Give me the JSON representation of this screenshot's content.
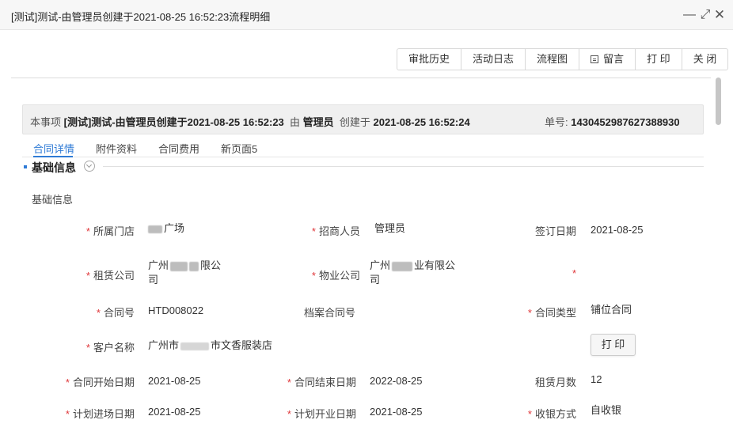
{
  "window": {
    "title": "[测试]测试-由管理员创建于2021-08-25 16:52:23流程明细",
    "minimize": "—",
    "maximize": "⤢",
    "close": "✕"
  },
  "toolbar": {
    "history": "审批历史",
    "activity_log": "活动日志",
    "flowchart": "流程图",
    "message": "留言",
    "print": "打 印",
    "close": "关 闭"
  },
  "info": {
    "prefix": "本事项",
    "item": "[测试]测试-由管理员创建于2021-08-25 16:52:23",
    "by": "由",
    "creator": "管理员",
    "created_at_label": "创建于",
    "created_at": "2021-08-25 16:52:24",
    "number_label": "单号:",
    "number": "1430452987627388930"
  },
  "tabs": [
    "合同详情",
    "附件资料",
    "合同费用",
    "新页面5"
  ],
  "section": {
    "title": "基础信息",
    "subheading": "基础信息"
  },
  "form": {
    "store_label": "所属门店",
    "store_value": "广场",
    "merchant_label": "招商人员",
    "merchant_value": "管理员",
    "sign_date_label": "签订日期",
    "sign_date_value": "2021-08-25",
    "lessor_label": "租赁公司",
    "lessor_value_a": "广州",
    "lessor_value_b": "限公",
    "lessor_value_c": "司",
    "property_label": "物业公司",
    "property_value_a": "广州",
    "property_value_b": "业有限公",
    "property_value_c": "司",
    "contract_no_label": "合同号",
    "contract_no_value": "HTD008022",
    "archive_no_label": "档案合同号",
    "contract_type_label": "合同类型",
    "contract_type_value": "铺位合同",
    "customer_label": "客户名称",
    "customer_value_a": "广州市",
    "customer_value_b": "市文香服装店",
    "start_date_label": "合同开始日期",
    "start_date_value": "2021-08-25",
    "end_date_label": "合同结束日期",
    "end_date_value": "2022-08-25",
    "lease_months_label": "租赁月数",
    "lease_months_value": "12",
    "move_in_label": "计划进场日期",
    "move_in_value": "2021-08-25",
    "opening_label": "计划开业日期",
    "opening_value": "2021-08-25",
    "cashier_label": "收银方式",
    "cashier_value": "自收银",
    "required_mark": "*",
    "print_button": "打 印"
  },
  "colors": {
    "accent": "#2f7bd6",
    "required": "#e0373a"
  }
}
